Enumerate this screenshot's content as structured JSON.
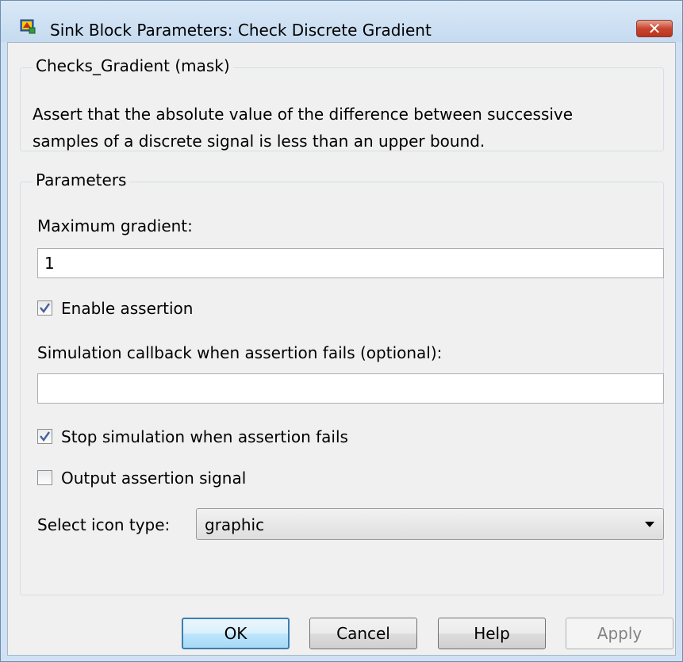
{
  "window": {
    "title": "Sink Block Parameters: Check Discrete Gradient",
    "close_label": "✕"
  },
  "mask_group": {
    "legend": "Checks_Gradient (mask)",
    "description_line1": "Assert that the absolute value of the difference between successive",
    "description_line2": "samples of a discrete signal is less than an upper bound."
  },
  "params_group": {
    "legend": "Parameters",
    "max_gradient_label": "Maximum gradient:",
    "max_gradient_value": "1",
    "enable_assertion_label": "Enable assertion",
    "enable_assertion_checked": true,
    "callback_label": "Simulation callback when assertion fails (optional):",
    "callback_value": "",
    "stop_sim_label": "Stop simulation when assertion fails",
    "stop_sim_checked": true,
    "output_signal_label": "Output assertion signal",
    "output_signal_checked": false,
    "icon_type_label": "Select icon type:",
    "icon_type_value": "graphic"
  },
  "buttons": {
    "ok": "OK",
    "cancel": "Cancel",
    "help": "Help",
    "apply": "Apply"
  },
  "colors": {
    "check_mark": "#4a5f9b",
    "default_button_border": "#3c7fb1",
    "close_button": "#c9452f"
  }
}
